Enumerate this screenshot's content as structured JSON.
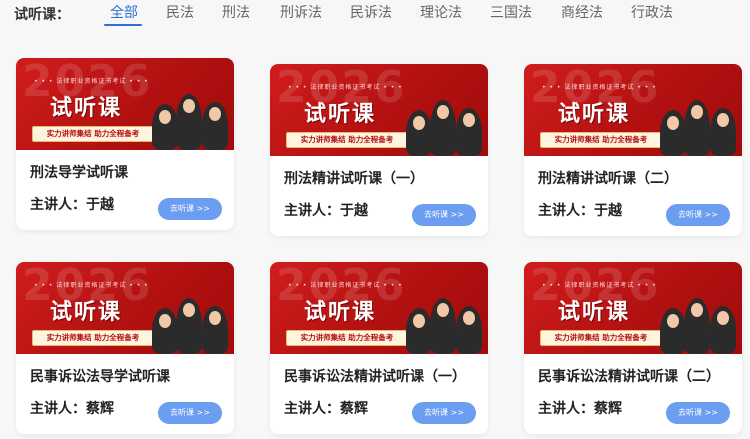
{
  "filter": {
    "label": "试听课：",
    "tabs": [
      "全部",
      "民法",
      "刑法",
      "刑诉法",
      "民诉法",
      "理论法",
      "三国法",
      "商经法",
      "行政法"
    ],
    "active_index": 0
  },
  "colors": {
    "accent": "#2f6fd8",
    "banner_red": "#c41515",
    "button_blue": "#6b9df0"
  },
  "banner": {
    "watermark": "2026",
    "cert_line": "• • • 法律职业资格证书考试 • • •",
    "title": "试听课",
    "slogan": "实力讲师集结 助力全程备考"
  },
  "cards": [
    {
      "title": "刑法导学试听课",
      "lecturer": "主讲人：于越",
      "button": "去听课 >>"
    },
    {
      "title": "刑法精讲试听课（一）",
      "lecturer": "主讲人：于越",
      "button": "去听课 >>"
    },
    {
      "title": "刑法精讲试听课（二）",
      "lecturer": "主讲人：于越",
      "button": "去听课 >>"
    },
    {
      "title": "民事诉讼法导学试听课",
      "lecturer": "主讲人：蔡辉",
      "button": "去听课 >>"
    },
    {
      "title": "民事诉讼法精讲试听课（一）",
      "lecturer": "主讲人：蔡辉",
      "button": "去听课 >>"
    },
    {
      "title": "民事诉讼法精讲试听课（二）",
      "lecturer": "主讲人：蔡辉",
      "button": "去听课 >>"
    }
  ]
}
